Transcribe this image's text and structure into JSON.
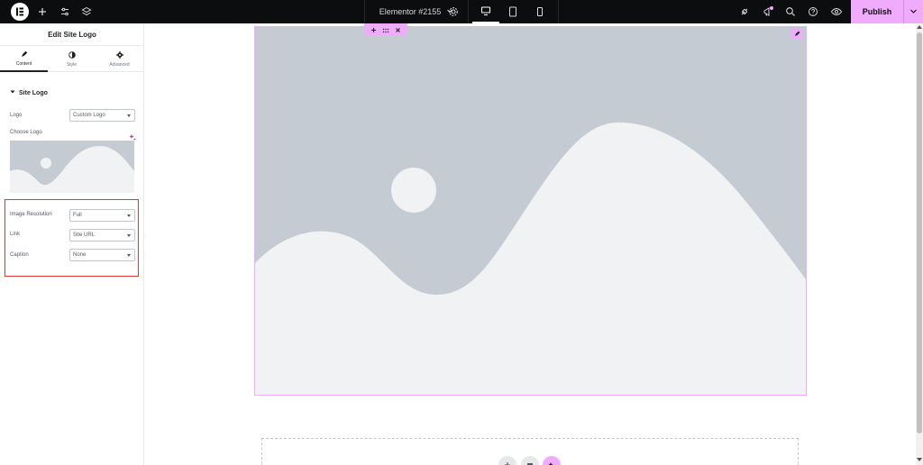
{
  "topbar": {
    "document_title": "Elementor #2155",
    "publish_label": "Publish",
    "left_icons": [
      "elementor-logo-icon",
      "add-element-icon",
      "site-settings-icon",
      "structure-layers-icon"
    ],
    "device_icons": [
      "desktop-icon",
      "tablet-icon",
      "mobile-icon"
    ],
    "right_icons": [
      "integrations-icon",
      "whats-new-icon",
      "finder-search-icon",
      "help-icon",
      "preview-eye-icon"
    ]
  },
  "panel": {
    "title": "Edit Site Logo",
    "tabs": [
      {
        "label": "Content",
        "icon": "pencil-icon",
        "active": true
      },
      {
        "label": "Style",
        "icon": "half-circle-icon",
        "active": false
      },
      {
        "label": "Advanced",
        "icon": "gear-icon",
        "active": false
      }
    ],
    "section_title": "Site Logo",
    "controls": {
      "logo": {
        "label": "Logo",
        "value": "Custom Logo"
      },
      "choose_logo": {
        "label": "Choose Logo"
      },
      "image_resolution": {
        "label": "Image Resolution",
        "value": "Full"
      },
      "link": {
        "label": "Link",
        "value": "Site URL"
      },
      "caption": {
        "label": "Caption",
        "value": "None"
      }
    }
  },
  "colors": {
    "accent": "#f0abfc",
    "highlight_border": "#e03b3b",
    "topbar_bg": "#0c0d0e",
    "placeholder_bg": "#c4cbd2",
    "placeholder_fg": "#f1f2f4"
  }
}
